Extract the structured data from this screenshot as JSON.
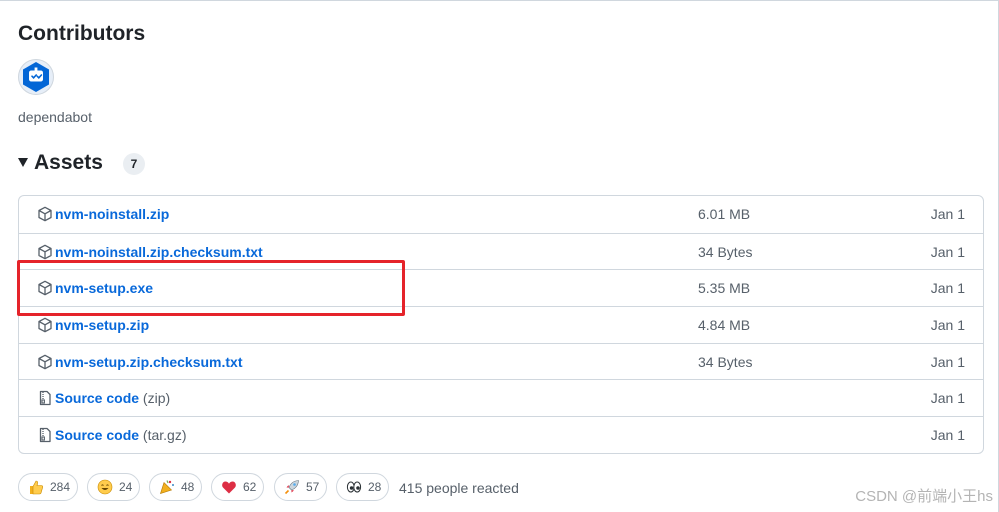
{
  "contributors": {
    "title": "Contributors",
    "avatar_icon": "dependabot-robot-icon",
    "name": "dependabot"
  },
  "assets": {
    "title": "Assets",
    "count": "7",
    "rows": [
      {
        "name": "nvm-noinstall.zip",
        "sub": "",
        "size": "6.01 MB",
        "date": "Jan 1",
        "icon": "package-icon"
      },
      {
        "name": "nvm-noinstall.zip.checksum.txt",
        "sub": "",
        "size": "34 Bytes",
        "date": "Jan 1",
        "icon": "package-icon"
      },
      {
        "name": "nvm-setup.exe",
        "sub": "",
        "size": "5.35 MB",
        "date": "Jan 1",
        "icon": "package-icon"
      },
      {
        "name": "nvm-setup.zip",
        "sub": "",
        "size": "4.84 MB",
        "date": "Jan 1",
        "icon": "package-icon"
      },
      {
        "name": "nvm-setup.zip.checksum.txt",
        "sub": "",
        "size": "34 Bytes",
        "date": "Jan 1",
        "icon": "package-icon"
      },
      {
        "name": "Source code",
        "sub": "(zip)",
        "size": "",
        "date": "Jan 1",
        "icon": "file-zip-icon"
      },
      {
        "name": "Source code",
        "sub": "(tar.gz)",
        "size": "",
        "date": "Jan 1",
        "icon": "file-zip-icon"
      }
    ]
  },
  "reactions": {
    "items": [
      {
        "emoji": "thumbs-up-icon",
        "count": "284"
      },
      {
        "emoji": "smile-icon",
        "count": "24"
      },
      {
        "emoji": "tada-icon",
        "count": "48"
      },
      {
        "emoji": "heart-icon",
        "count": "62"
      },
      {
        "emoji": "rocket-icon",
        "count": "57"
      },
      {
        "emoji": "eyes-icon",
        "count": "28"
      }
    ],
    "summary": "415 people reacted"
  },
  "watermark": "CSDN @前端小王hs",
  "colors": {
    "link": "#0969da",
    "highlight": "#e5232a",
    "dependabot": "#0366d6"
  }
}
